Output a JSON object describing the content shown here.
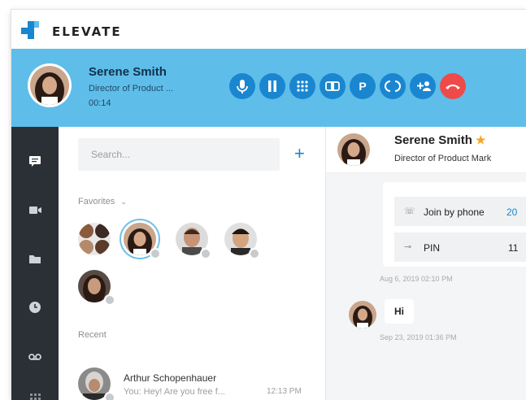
{
  "app": {
    "brand": "ELEVATE"
  },
  "call": {
    "name": "Serene Smith",
    "title": "Director of Product ...",
    "timer": "00:14",
    "controls": [
      {
        "name": "microphone-icon",
        "glyph": "●"
      },
      {
        "name": "pause-icon",
        "glyph": "||"
      },
      {
        "name": "dialpad-icon",
        "glyph": "⋮⋮"
      },
      {
        "name": "record-icon",
        "glyph": "CD"
      },
      {
        "name": "park-icon",
        "glyph": "P"
      },
      {
        "name": "transfer-icon",
        "glyph": "⇄"
      },
      {
        "name": "add-participant-icon",
        "glyph": "+"
      },
      {
        "name": "hang-up-icon",
        "glyph": "☎"
      }
    ]
  },
  "contacts": {
    "search_placeholder": "Search...",
    "favorites_label": "Favorites",
    "recent_label": "Recent",
    "recent": {
      "name": "Arthur Schopenhauer",
      "preview": "You: Hey! Are you free f...",
      "time": "12:13 PM"
    }
  },
  "chat": {
    "name": "Serene Smith",
    "title": "Director of Product Mark",
    "card": {
      "join_label": "Join by phone",
      "join_value": "20",
      "pin_label": "PIN",
      "pin_value": "11"
    },
    "card_timestamp": "Aug 6, 2019 02:10 PM",
    "message": "Hi",
    "message_timestamp": "Sep 23, 2019 01:36 PM"
  },
  "colors": {
    "callbar": "#5fbde9",
    "accent": "#1a86cf",
    "hangup": "#ef4a4a",
    "sidebar": "#2b3036",
    "star": "#f4a623"
  }
}
